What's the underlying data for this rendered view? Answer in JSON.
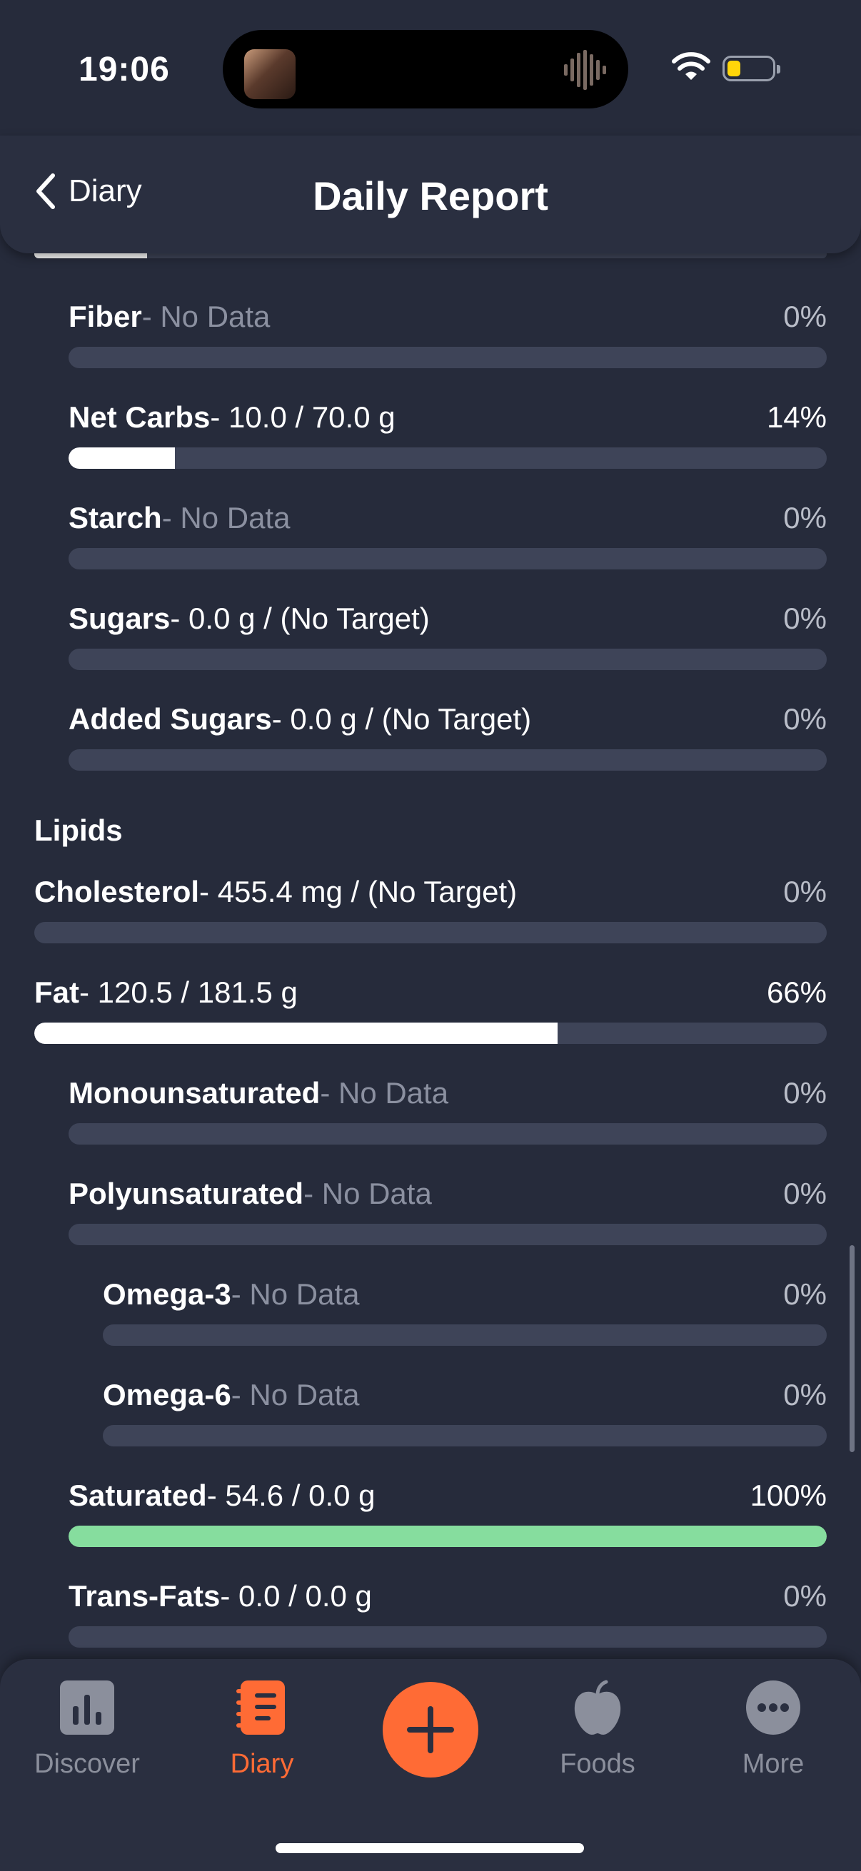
{
  "status_bar": {
    "time": "19:06"
  },
  "header": {
    "back_label": "Diary",
    "title": "Daily Report"
  },
  "top_progress_fraction": 0.14,
  "carb_rows": [
    {
      "name": "Fiber",
      "value": "- No Data",
      "no_data": true,
      "percent": "0%",
      "fill": 0
    },
    {
      "name": "Net Carbs",
      "value": "- 10.0 / 70.0 g",
      "no_data": false,
      "percent": "14%",
      "fill": 0.14
    },
    {
      "name": "Starch",
      "value": "- No Data",
      "no_data": true,
      "percent": "0%",
      "fill": 0
    },
    {
      "name": "Sugars",
      "value": "- 0.0 g / (No Target)",
      "no_data": false,
      "percent": "0%",
      "fill": 0
    },
    {
      "name": "Added Sugars",
      "value": "- 0.0 g / (No Target)",
      "no_data": false,
      "percent": "0%",
      "fill": 0
    }
  ],
  "lipids": {
    "section_title": "Lipids",
    "rows": [
      {
        "name": "Cholesterol",
        "value": "- 455.4 mg / (No Target)",
        "no_data": false,
        "percent": "0%",
        "fill": 0
      },
      {
        "name": "Fat",
        "value": "- 120.5 / 181.5 g",
        "no_data": false,
        "percent": "66%",
        "fill": 0.66
      },
      {
        "name": "Monounsaturated",
        "value": "- No Data",
        "no_data": true,
        "percent": "0%",
        "fill": 0
      },
      {
        "name": "Polyunsaturated",
        "value": "- No Data",
        "no_data": true,
        "percent": "0%",
        "fill": 0
      },
      {
        "name": "Omega-3",
        "value": "- No Data",
        "no_data": true,
        "percent": "0%",
        "fill": 0
      },
      {
        "name": "Omega-6",
        "value": "- No Data",
        "no_data": true,
        "percent": "0%",
        "fill": 0
      },
      {
        "name": "Saturated",
        "value": "- 54.6 / 0.0 g",
        "no_data": false,
        "percent": "100%",
        "fill": 1.0
      },
      {
        "name": "Trans-Fats",
        "value": "- 0.0 / 0.0 g",
        "no_data": false,
        "percent": "0%",
        "fill": 0
      }
    ]
  },
  "tabbar": {
    "items": [
      {
        "label": "Discover",
        "icon": "bar-chart-icon",
        "active": false
      },
      {
        "label": "Diary",
        "icon": "notebook-icon",
        "active": true
      },
      {
        "label": "Foods",
        "icon": "apple-icon",
        "active": false
      },
      {
        "label": "More",
        "icon": "more-dots-icon",
        "active": false
      }
    ],
    "add_icon": "plus-icon"
  },
  "colors": {
    "background": "#262b3b",
    "accent": "#ff6b35",
    "complete": "#86dd9e",
    "track": "#3e4458"
  }
}
